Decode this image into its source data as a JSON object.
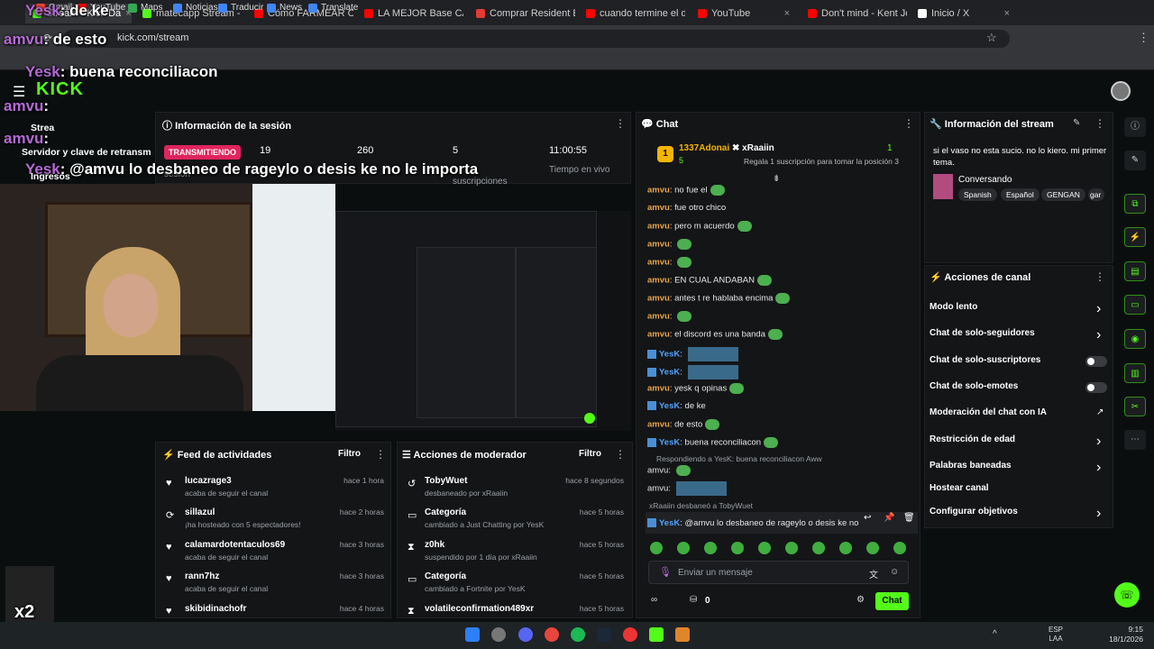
{
  "browser": {
    "tabs": [
      {
        "label": "Stream - Kick Da",
        "color": "#53fc18"
      },
      {
        "label": "matecapp Stream - V",
        "color": "#53fc18"
      },
      {
        "label": "Cómo FARMEAR CRC",
        "color": "#ff0000"
      },
      {
        "label": "LA MEJOR Base CAST",
        "color": "#ff0000"
      },
      {
        "label": "Comprar Resident Ev",
        "color": "#e53935"
      },
      {
        "label": "cuando termine el di",
        "color": "#ff0000"
      },
      {
        "label": "YouTube",
        "color": "#ff0000"
      },
      {
        "label": "Don't mind - Kent Jo",
        "color": "#ff0000"
      },
      {
        "label": "Inicio / X",
        "color": "#ffffff"
      }
    ],
    "url": "kick.com/stream",
    "bookmarks": [
      "Gmail",
      "YouTube",
      "Maps",
      "Noticias",
      "Traducir",
      "News",
      "Translate"
    ]
  },
  "overlay": {
    "lines": [
      {
        "user": "Yesk",
        "text": ": de ke"
      },
      {
        "user": "amvu",
        "text": ": de esto"
      },
      {
        "user": "Yesk",
        "text": ": buena reconciliacon"
      },
      {
        "user": "amvu",
        "text": ":"
      },
      {
        "user": "amvu",
        "text": ":"
      },
      {
        "user": "Yesk",
        "text": ": @amvu lo desbaneo de rageylo o desis ke no le importa"
      }
    ],
    "x2": "x2",
    "side_items": [
      "Strea",
      "Servidor y clave de retransm",
      "Ingresos"
    ]
  },
  "session": {
    "title": "Información de la sesión",
    "live_badge": "TRANSMITIENDO",
    "stats": [
      {
        "value": "19",
        "label": "sesión"
      },
      {
        "value": "260",
        "label": ""
      },
      {
        "value": "5",
        "label": "suscripciones"
      },
      {
        "value": "11:00:55",
        "label": "Tiempo en vivo"
      }
    ]
  },
  "feed": {
    "title": "Feed de actividades",
    "filter": "Filtro",
    "items": [
      {
        "icon": "heart",
        "name": "lucazrage3",
        "sub": "acaba de seguir el canal",
        "time": "hace 1 hora"
      },
      {
        "icon": "host",
        "name": "sillazul",
        "sub": "¡ha hosteado con 5 espectadores!",
        "time": "hace 2 horas"
      },
      {
        "icon": "heart",
        "name": "calamardotentaculos69",
        "sub": "acaba de seguir el canal",
        "time": "hace 3 horas"
      },
      {
        "icon": "heart",
        "name": "rann7hz",
        "sub": "acaba de seguir el canal",
        "time": "hace 3 horas"
      },
      {
        "icon": "heart",
        "name": "skibidinachofr",
        "sub": "",
        "time": "hace 4 horas"
      }
    ]
  },
  "modactions": {
    "title": "Acciones de moderador",
    "filter": "Filtro",
    "items": [
      {
        "name": "TobyWuet",
        "sub": "desbaneado por xRaaiin",
        "time": "hace 8 segundos"
      },
      {
        "name": "Categoría",
        "sub": "cambiado a Just Chatting por YesK",
        "time": "hace 5 horas"
      },
      {
        "name": "z0hk",
        "sub": "suspendido por 1 día por xRaaiin",
        "time": "hace 5 horas"
      },
      {
        "name": "Categoría",
        "sub": "cambiado a Fortnite por YesK",
        "time": "hace 5 horas"
      },
      {
        "name": "volatileconfirmation489xr",
        "sub": "",
        "time": "hace 5 horas"
      }
    ]
  },
  "chat": {
    "title": "Chat",
    "leader": {
      "rank": "1",
      "name": "1337Adonai",
      "count": "5"
    },
    "sub_user": "xRaaiin",
    "sub_count": "1",
    "sub_promo": "Regala 1 suscripción para tomar la posición 3",
    "messages": [
      {
        "user": "amvu",
        "text": "no fue el",
        "emote": true
      },
      {
        "user": "amvu",
        "text": "fue otro chico",
        "emote": false
      },
      {
        "user": "amvu",
        "text": "pero m acuerdo",
        "emote": true
      },
      {
        "user": "amvu",
        "text": "",
        "emote": true
      },
      {
        "user": "amvu",
        "text": "",
        "emote": true
      },
      {
        "user": "amvu",
        "text": "EN CUAL ANDABAN",
        "emote": true
      },
      {
        "user": "amvu",
        "text": "antes t re hablaba encima",
        "emote": true
      },
      {
        "user": "amvu",
        "text": "",
        "emote": true
      },
      {
        "user": "amvu",
        "text": "el discord es una banda",
        "emote": true
      },
      {
        "user": "YesK",
        "text": "",
        "emote": false,
        "image": true
      },
      {
        "user": "YesK",
        "text": "",
        "emote": false,
        "image": true
      },
      {
        "user": "amvu",
        "text": "yesk q opinas",
        "emote": true
      },
      {
        "user": "YesK",
        "text": "de ke",
        "emote": false
      },
      {
        "user": "amvu",
        "text": "de esto",
        "emote": true
      },
      {
        "user": "YesK",
        "text": "buena reconciliacon",
        "emote": true
      }
    ],
    "reply_note": "Respondiendo a YesK: buena reconciliacon Aww",
    "unban_note": "xRaaiin desbaneó a TobyWuet",
    "last_user": "YesK",
    "last_text": "@amvu lo desbaneo de rageylo o desis ke no",
    "input_placeholder": "Enviar un mensaje",
    "points": "0",
    "send": "Chat"
  },
  "stream_info": {
    "title": "Información del stream",
    "stream_title": "si el vaso no esta sucio. no lo kiero. mi primer tema.",
    "category": "Conversando",
    "tags": [
      "Spanish",
      "Español",
      "GENGAN",
      "gar"
    ]
  },
  "channel_actions": {
    "title": "Acciones de canal",
    "items": [
      {
        "label": "Modo lento",
        "control": "chevron"
      },
      {
        "label": "Chat de solo-seguidores",
        "control": "chevron"
      },
      {
        "label": "Chat de solo-suscriptores",
        "control": "toggle"
      },
      {
        "label": "Chat de solo-emotes",
        "control": "toggle"
      },
      {
        "label": "Moderación del chat con IA",
        "control": "link"
      },
      {
        "label": "Restricción de edad",
        "control": "chevron"
      },
      {
        "label": "Palabras baneadas",
        "control": "chevron"
      },
      {
        "label": "Hostear canal",
        "control": "none"
      },
      {
        "label": "Configurar objetivos",
        "control": "chevron"
      }
    ]
  },
  "taskbar": {
    "lang": "ESP",
    "lang2": "LAA",
    "time": "9:15",
    "date": "18/1/2026"
  }
}
